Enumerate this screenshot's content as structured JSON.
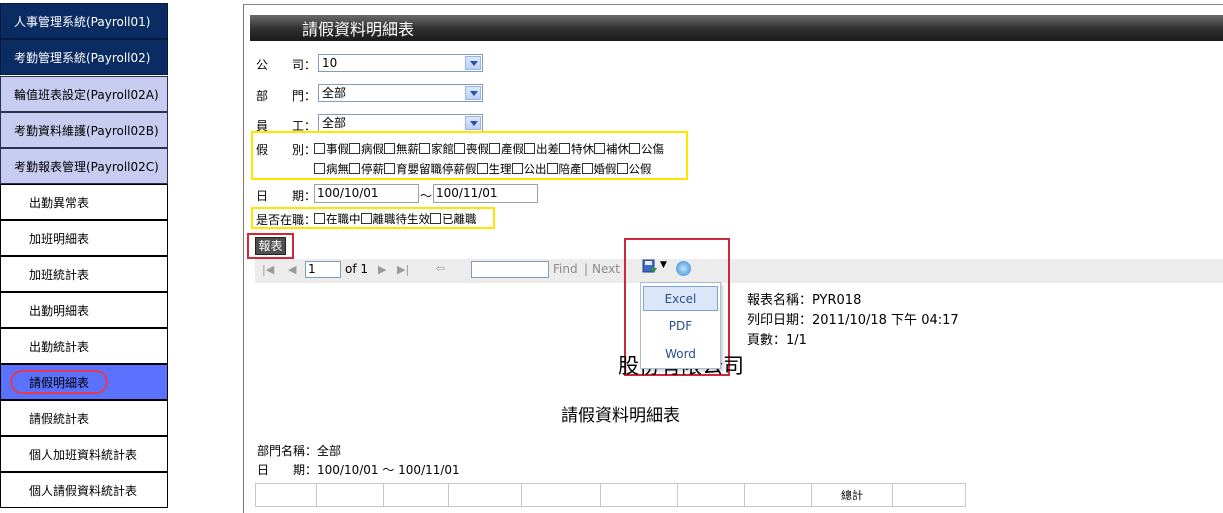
{
  "sidebar": {
    "items": [
      {
        "label": "人事管理系統(Payroll01)",
        "level": "top"
      },
      {
        "label": "考勤管理系統(Payroll02)",
        "level": "top"
      },
      {
        "label": "輪值班表設定(Payroll02A)",
        "level": "mid"
      },
      {
        "label": "考勤資料維護(Payroll02B)",
        "level": "mid"
      },
      {
        "label": "考勤報表管理(Payroll02C)",
        "level": "mid"
      },
      {
        "label": "出勤異常表",
        "level": "leaf"
      },
      {
        "label": "加班明細表",
        "level": "leaf"
      },
      {
        "label": "加班統計表",
        "level": "leaf"
      },
      {
        "label": "出勤明細表",
        "level": "leaf"
      },
      {
        "label": "出勤統計表",
        "level": "leaf"
      },
      {
        "label": "請假明細表",
        "level": "leaf",
        "active": true
      },
      {
        "label": "請假統計表",
        "level": "leaf"
      },
      {
        "label": "個人加班資料統計表",
        "level": "leaf"
      },
      {
        "label": "個人請假資料統計表",
        "level": "leaf"
      }
    ]
  },
  "page_title": "請假資料明細表",
  "form": {
    "company_label": "公　　司：",
    "company_value": "10",
    "dept_label": "部　　門：",
    "dept_value": "全部",
    "emp_label": "員　　工：",
    "emp_value": "全部",
    "leave_label": "假　　別：",
    "leave_types_row1": [
      "事假",
      "病假",
      "無薪",
      "家館",
      "喪假",
      "產假",
      "出差",
      "特休",
      "補休",
      "公傷"
    ],
    "leave_types_row2": [
      "病無",
      "停薪",
      "育嬰留職停薪假",
      "生理",
      "公出",
      "陪產",
      "婚假",
      "公假"
    ],
    "date_label": "日　　期：",
    "date_from": "100/10/01",
    "date_sep": "～",
    "date_to": "100/11/01",
    "employed_label": "是否在職：",
    "employed_options": [
      "在職中",
      "離職待生效",
      "已離職"
    ],
    "report_button": "報表"
  },
  "toolbar": {
    "page_value": "1",
    "of_text": "of 1",
    "find_label": "Find",
    "separator": "|",
    "next_label": "Next"
  },
  "export_menu": {
    "options": [
      "Excel",
      "PDF",
      "Word"
    ],
    "highlighted": "Excel"
  },
  "report": {
    "name_line": "報表名稱：PYR018",
    "print_date_line": "列印日期：2011/10/18 下午 04:17",
    "pages_line": "頁數：1/1",
    "company_partial": "股份有限公司",
    "title": "請假資料明細表",
    "dept_line": "部門名稱：全部",
    "date_line": "日　　期：100/10/01 ～ 100/11/01",
    "table_total_header": "總計"
  },
  "colors": {
    "nav_top": "#0b2b63",
    "nav_mid": "#c8ccf0",
    "nav_active": "#5a72ff",
    "highlight_yellow": "#ffe500",
    "highlight_red": "#d0283a"
  }
}
